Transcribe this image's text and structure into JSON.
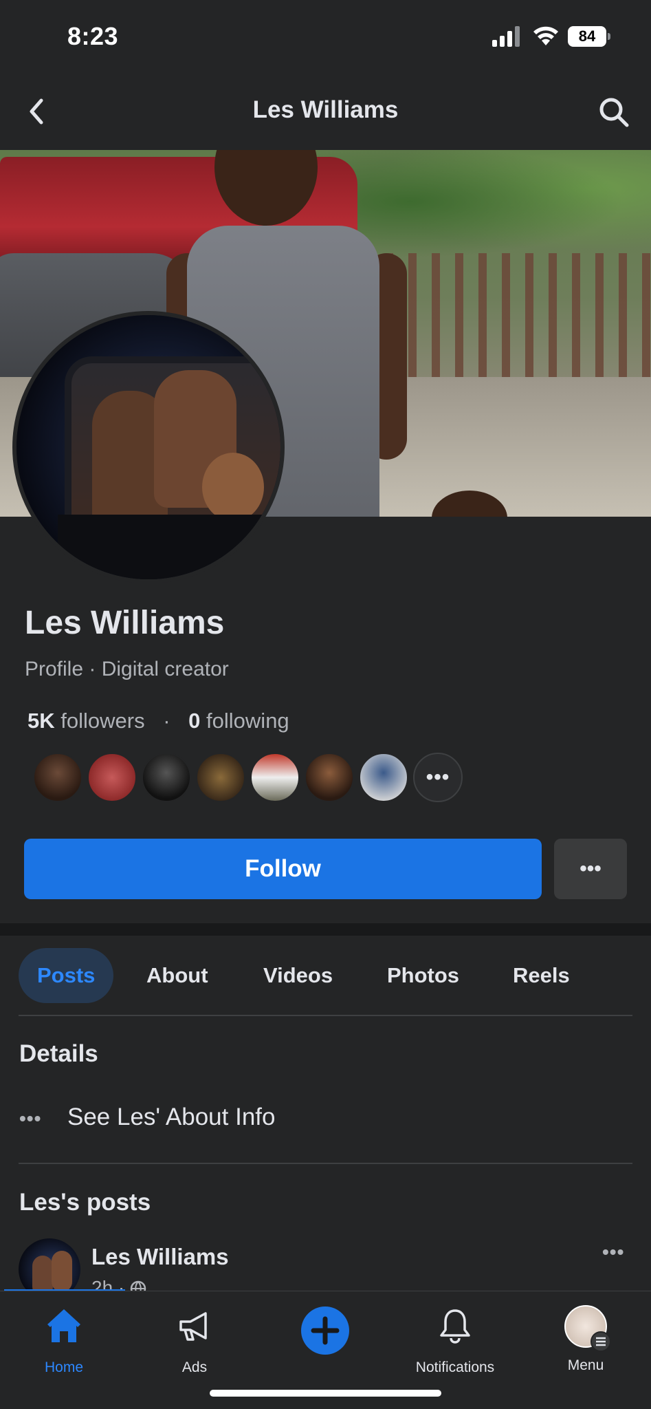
{
  "status_bar": {
    "time": "8:23",
    "battery": "84"
  },
  "header": {
    "title": "Les Williams",
    "back_icon": "chevron-left-icon",
    "search_icon": "search-icon"
  },
  "profile": {
    "name": "Les Williams",
    "subtitle": "Profile · Digital creator",
    "followers_count": "5K",
    "followers_label": "followers",
    "separator": "·",
    "following_count": "0",
    "following_label": "following",
    "follower_avatars_count": 7,
    "more_followers_label": "•••"
  },
  "actions": {
    "follow_label": "Follow",
    "more_label": "•••"
  },
  "tabs": [
    {
      "label": "Posts",
      "active": true
    },
    {
      "label": "About",
      "active": false
    },
    {
      "label": "Videos",
      "active": false
    },
    {
      "label": "Photos",
      "active": false
    },
    {
      "label": "Reels",
      "active": false
    }
  ],
  "details": {
    "heading": "Details",
    "about_link": "See Les' About Info",
    "dots": "•••"
  },
  "posts": {
    "heading": "Les's posts",
    "items": [
      {
        "author": "Les Williams",
        "time": "2h · ",
        "more": "•••"
      }
    ]
  },
  "bottom_nav": [
    {
      "label": "Home",
      "icon": "home-icon",
      "active": true
    },
    {
      "label": "Ads",
      "icon": "megaphone-icon",
      "active": false
    },
    {
      "label": "",
      "icon": "plus-icon",
      "active": false
    },
    {
      "label": "Notifications",
      "icon": "bell-icon",
      "active": false
    },
    {
      "label": "Menu",
      "icon": "menu-avatar-icon",
      "active": false
    }
  ],
  "colors": {
    "accent": "#1b74e4",
    "background": "#242526",
    "text": "#e4e6eb",
    "muted": "#b0b3b8",
    "active_tab_bg": "#263951"
  }
}
